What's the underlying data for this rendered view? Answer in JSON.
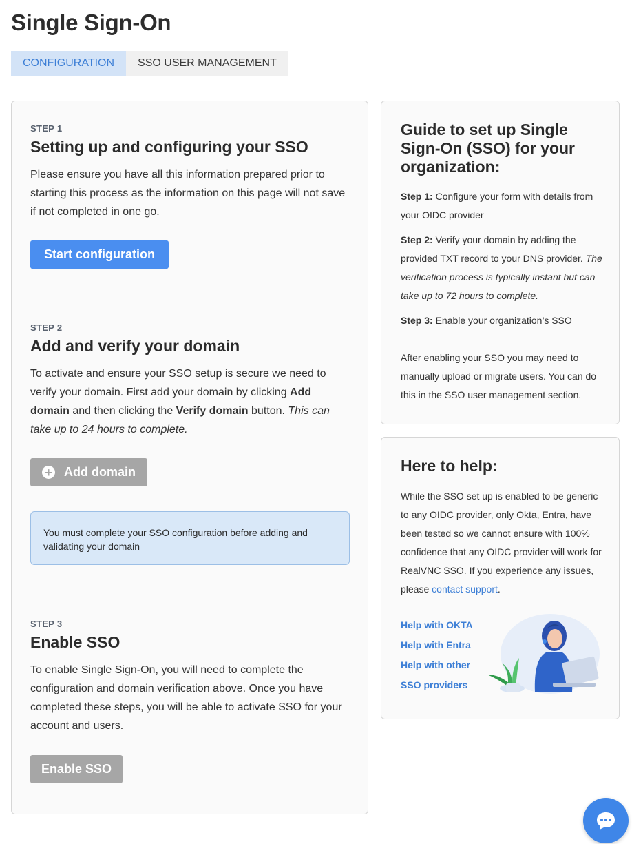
{
  "page": {
    "title": "Single Sign-On"
  },
  "tabs": [
    {
      "label": "CONFIGURATION",
      "active": true
    },
    {
      "label": "SSO USER MANAGEMENT",
      "active": false
    }
  ],
  "steps": {
    "step1": {
      "label": "STEP 1",
      "title": "Setting up and configuring your SSO",
      "text": "Please ensure you have all this information prepared prior to starting this process as the information on this page will not save if not completed in one go.",
      "button": "Start configuration"
    },
    "step2": {
      "label": "STEP 2",
      "title": "Add and verify your domain",
      "text_a": "To activate and ensure your SSO setup is secure we need to verify your domain. First add your domain by clicking ",
      "text_b": "Add domain",
      "text_c": " and then clicking the ",
      "text_d": "Verify domain",
      "text_e": " button. ",
      "text_f": "This can take up to 24 hours to complete.",
      "button": "Add domain",
      "notice": "You must complete your SSO configuration before adding and validating your domain"
    },
    "step3": {
      "label": "STEP 3",
      "title": "Enable SSO",
      "text": "To enable Single Sign-On, you will need to complete the configuration and domain verification above. Once you have completed these steps, you will be able to activate SSO for your account and users.",
      "button": "Enable SSO"
    }
  },
  "guide": {
    "title": "Guide to set up Single Sign-On (SSO) for your organization:",
    "s1_label": "Step 1:",
    "s1_text": " Configure your form with details from your OIDC provider",
    "s2_label": "Step 2:",
    "s2_text": " Verify your domain by adding the provided TXT record to your DNS provider. ",
    "s2_italic": "The verification process is typically instant but can take up to 72 hours to complete.",
    "s3_label": "Step 3:",
    "s3_text": " Enable your organization’s SSO",
    "after": "After enabling your SSO you may need to manually upload or migrate users. You can do this in the SSO user management section."
  },
  "help": {
    "title": "Here to help:",
    "text": "While the SSO set up is enabled to be generic to any OIDC provider, only Okta, Entra, have been tested so we cannot ensure with 100% confidence that any OIDC provider will work for RealVNC SSO. If you experience any issues, please ",
    "contact_link": "contact support",
    "text_end": ".",
    "links": [
      "Help with OKTA",
      "Help with Entra",
      "Help with other",
      "SSO providers"
    ]
  },
  "colors": {
    "accent": "#4a8ef0",
    "link": "#3d7fd6",
    "disabled": "#a6a6a6",
    "notice_bg": "#d9e8f8"
  },
  "icons": {
    "add": "plus-circle-icon",
    "chat": "chat-bubble-icon"
  }
}
